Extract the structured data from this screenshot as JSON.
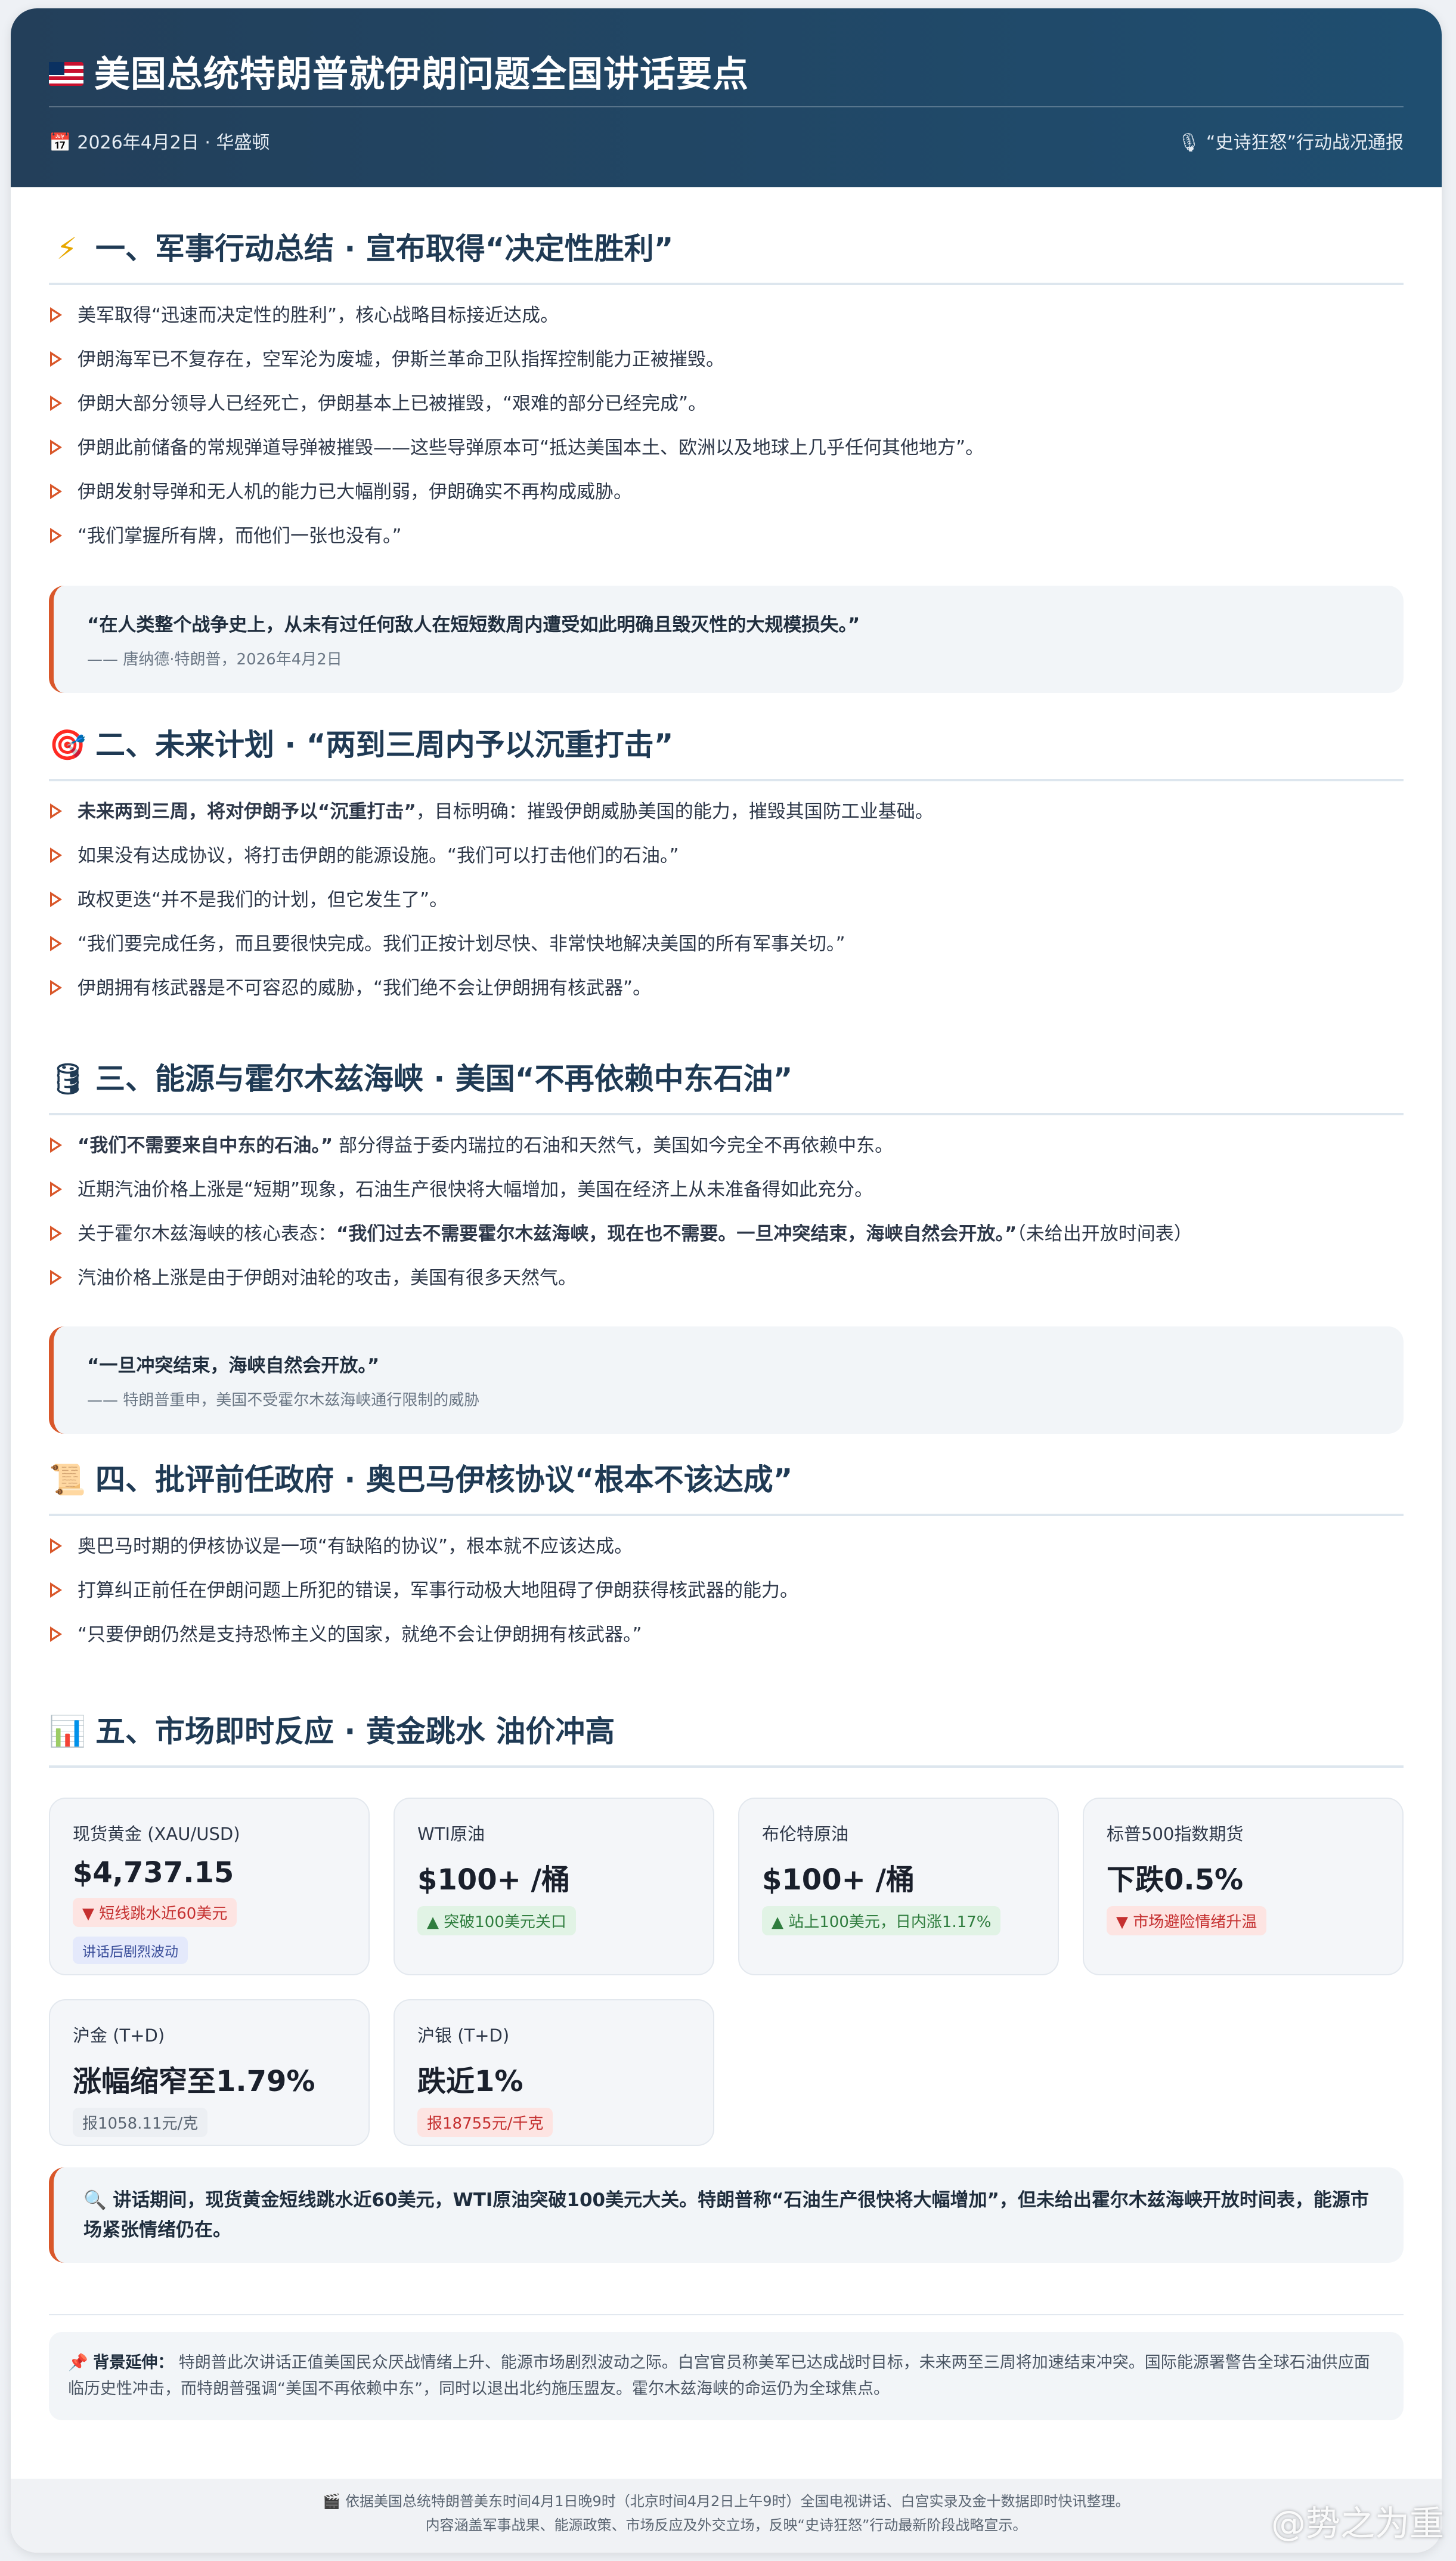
{
  "header": {
    "title": "美国总统特朗普就伊朗问题全国讲话要点",
    "date_place": "2026年4月2日 · 华盛顿",
    "op_status": "“史诗狂怒”行动战况通报"
  },
  "s1": {
    "title": "一、军事行动总结 · 宣布取得“决定性胜利”",
    "items": [
      "美军取得“迅速而决定性的胜利”，核心战略目标接近达成。",
      "伊朗海军已不复存在，空军沦为废墟，伊斯兰革命卫队指挥控制能力正被摧毁。",
      "伊朗大部分领导人已经死亡，伊朗基本上已被摧毁，“艰难的部分已经完成”。",
      "伊朗此前储备的常规弹道导弹被摧毁——这些导弹原本可“抵达美国本土、欧洲以及地球上几乎任何其他地方”。",
      "伊朗发射导弹和无人机的能力已大幅削弱，伊朗确实不再构成威胁。",
      "“我们掌握所有牌，而他们一张也没有。”"
    ],
    "quote": "“在人类整个战争史上，从未有过任何敌人在短短数周内遭受如此明确且毁灭性的大规模损失。”",
    "quote_attr": "—— 唐纳德·特朗普，2026年4月2日"
  },
  "s2": {
    "title": "二、未来计划 · “两到三周内予以沉重打击”",
    "item1_bold": "未来两到三周，将对伊朗予以“沉重打击”",
    "item1_rest": "，目标明确：摧毁伊朗威胁美国的能力，摧毁其国防工业基础。",
    "items": [
      "如果没有达成协议，将打击伊朗的能源设施。“我们可以打击他们的石油。”",
      "政权更迭“并不是我们的计划，但它发生了”。",
      "“我们要完成任务，而且要很快完成。我们正按计划尽快、非常快地解决美国的所有军事关切。”",
      "伊朗拥有核武器是不可容忍的威胁，“我们绝不会让伊朗拥有核武器”。"
    ]
  },
  "s3": {
    "title": "三、能源与霍尔木兹海峡 · 美国“不再依赖中东石油”",
    "item1_bold": "“我们不需要来自中东的石油。”",
    "item1_rest": "部分得益于委内瑞拉的石油和天然气，美国如今完全不再依赖中东。",
    "item2": "近期汽油价格上涨是“短期”现象，石油生产很快将大幅增加，美国在经济上从未准备得如此充分。",
    "item3_pre": "关于霍尔木兹海峡的核心表态：",
    "item3_bold": "“我们过去不需要霍尔木兹海峡，现在也不需要。一旦冲突结束，海峡自然会开放。”",
    "item3_post": "（未给出开放时间表）",
    "item4": "汽油价格上涨是由于伊朗对油轮的攻击，美国有很多天然气。",
    "quote": "“一旦冲突结束，海峡自然会开放。”",
    "quote_attr": "—— 特朗普重申，美国不受霍尔木兹海峡通行限制的威胁"
  },
  "s4": {
    "title": "四、批评前任政府 · 奥巴马伊核协议“根本不该达成”",
    "items": [
      "奥巴马时期的伊核协议是一项“有缺陷的协议”，根本就不应该达成。",
      "打算纠正前任在伊朗问题上所犯的错误，军事行动极大地阻碍了伊朗获得核武器的能力。",
      "“只要伊朗仍然是支持恐怖主义的国家，就绝不会让伊朗拥有核武器。”"
    ]
  },
  "s5": {
    "title": "五、市场即时反应 · 黄金跳水 油价冲高",
    "cards": [
      {
        "label": "现货黄金 (XAU/USD)",
        "value": "$4,737.15",
        "tag": "▼ 短线跳水近60美元",
        "extra": "讲话后剧烈波动"
      },
      {
        "label": "WTI原油",
        "value": "$100+ /桶",
        "tag": "▲ 突破100美元关口"
      },
      {
        "label": "布伦特原油",
        "value": "$100+ /桶",
        "tag": "▲ 站上100美元，日内涨1.17%"
      },
      {
        "label": "标普500指数期货",
        "value": "下跌0.5%",
        "tag": "▼ 市场避险情绪升温"
      },
      {
        "label": "沪金 (T+D)",
        "value": "涨幅缩窄至1.79%",
        "tag": "报1058.11元/克"
      },
      {
        "label": "沪银 (T+D)",
        "value": "跌近1%",
        "tag": "报18755元/千克"
      }
    ],
    "note": "讲话期间，现货黄金短线跳水近60美元，WTI原油突破100美元大关。特朗普称“石油生产很快将大幅增加”，但未给出霍尔木兹海峡开放时间表，能源市场紧张情绪仍在。"
  },
  "background": {
    "label": "背景延伸：",
    "text": "特朗普此次讲话正值美国民众厌战情绪上升、能源市场剧烈波动之际。白宫官员称美军已达成战时目标，未来两至三周将加速结束冲突。国际能源署警告全球石油供应面临历史性冲击，而特朗普强调“美国不再依赖中东”，同时以退出北约施压盟友。霍尔木兹海峡的命运仍为全球焦点。"
  },
  "footer": {
    "line1": "依据美国总统特朗普美东时间4月1日晚9时（北京时间4月2日上午9时）全国电视讲话、白宫实录及金十数据即时快讯整理。",
    "line2": "内容涵盖军事战果、能源政策、市场反应及外交立场，反映“史诗狂怒”行动最新阶段战略宣示。"
  },
  "watermark": "@势之为重",
  "icons": {
    "s1": "lightning-icon",
    "s2": "target-icon",
    "s3": "oil-barrel-icon",
    "s4": "scroll-icon",
    "s5": "bar-chart-icon",
    "note": "magnifier-icon",
    "bg": "pin-icon",
    "footer": "clapper-icon"
  },
  "colors": {
    "header": "#1f4e70",
    "accent": "#d9572a",
    "down": "#c53030",
    "up": "#2f7d3e"
  }
}
